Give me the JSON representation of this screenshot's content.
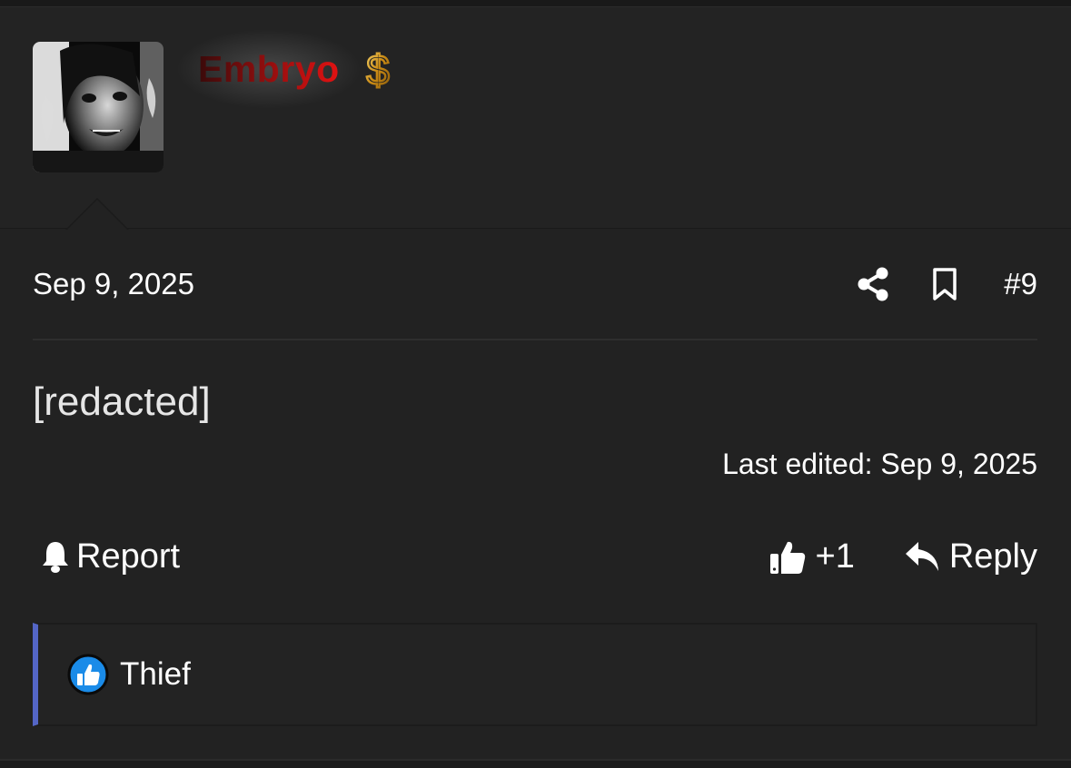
{
  "user": {
    "username": "Embryo",
    "username_colors": [
      "#3a0a0a",
      "#e21212"
    ],
    "badge_icon": "dollar-sign-icon",
    "badge_color": "#d9a520"
  },
  "post": {
    "date": "Sep 9, 2025",
    "number": "#9",
    "body": "[redacted]",
    "last_edited": "Last edited: Sep 9, 2025"
  },
  "actions": {
    "share_icon": "share-icon",
    "bookmark_icon": "bookmark-icon",
    "report_label": "Report",
    "like_label": "+1",
    "reply_label": "Reply"
  },
  "reactions": {
    "accent_color": "#5466c6",
    "icon": "thumbs-up-icon",
    "icon_color": "#1a8be8",
    "names": [
      "Thief"
    ]
  }
}
